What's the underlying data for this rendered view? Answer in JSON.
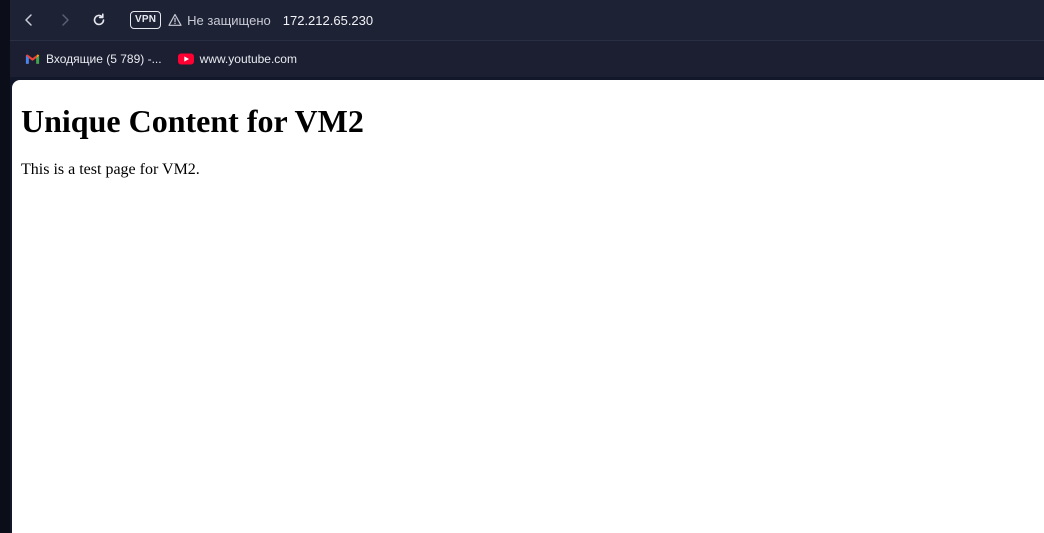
{
  "toolbar": {
    "vpn_label": "VPN",
    "security_text": "Не защищено",
    "url": "172.212.65.230"
  },
  "bookmarks": [
    {
      "label": "Входящие (5 789) -...",
      "icon": "gmail-icon"
    },
    {
      "label": "www.youtube.com",
      "icon": "youtube-icon"
    }
  ],
  "page": {
    "heading": "Unique Content for VM2",
    "paragraph": "This is a test page for VM2."
  },
  "colors": {
    "chrome_bg": "#1e2235",
    "bookmarks_bg": "#1b1f31",
    "page_bg": "#ffffff",
    "youtube_red": "#ff0033"
  }
}
